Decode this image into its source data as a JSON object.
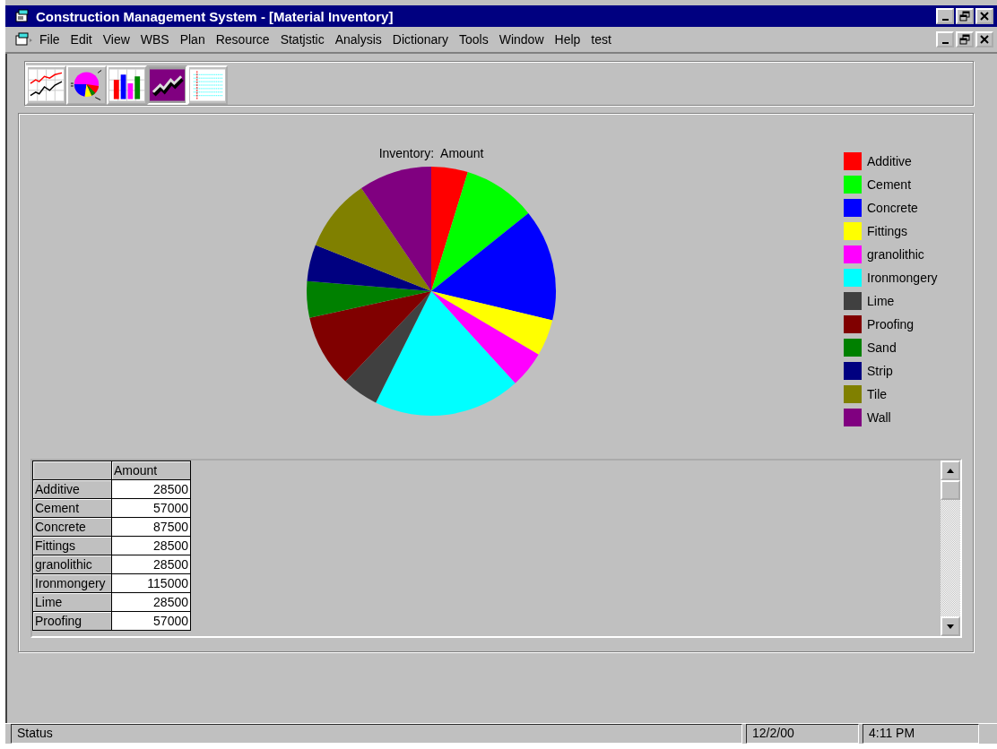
{
  "window": {
    "title": "Construction Management System - [Material Inventory]"
  },
  "menu": [
    "File",
    "Edit",
    "View",
    "WBS",
    "Plan",
    "Resource",
    "Statjstic",
    "Analysis",
    "Dictionary",
    "Tools",
    "Window",
    "Help",
    "test"
  ],
  "toolbar": [
    {
      "kind": "line",
      "selected": false
    },
    {
      "kind": "pie",
      "selected": false
    },
    {
      "kind": "bar",
      "selected": false
    },
    {
      "kind": "trend",
      "selected": true
    },
    {
      "kind": "grid",
      "selected": false
    }
  ],
  "chart": {
    "chart_data": {
      "type": "pie",
      "title": "Inventory:  Amount",
      "categories": [
        "Additive",
        "Cement",
        "Concrete",
        "Fittings",
        "granolithic",
        "Ironmongery",
        "Lime",
        "Proofing",
        "Sand",
        "Strip",
        "Tile",
        "Wall"
      ],
      "values": [
        4.74,
        9.48,
        14.54,
        4.74,
        4.74,
        19.1,
        4.74,
        9.48,
        4.74,
        4.74,
        9.48,
        9.48
      ]
    },
    "legend": [
      {
        "color": "#ff0000"
      },
      {
        "color": "#00ff00"
      },
      {
        "color": "#0000ff"
      },
      {
        "color": "#ffff00"
      },
      {
        "color": "#ff00ff"
      },
      {
        "color": "#00ffff"
      },
      {
        "color": "#404040"
      },
      {
        "color": "#800000"
      },
      {
        "color": "#008000"
      },
      {
        "color": "#000080"
      },
      {
        "color": "#808000"
      },
      {
        "color": "#800080"
      }
    ]
  },
  "table": {
    "columns": [
      "Amount"
    ],
    "rows": [
      {
        "label": "Additive",
        "amount": "28500"
      },
      {
        "label": "Cement",
        "amount": "57000"
      },
      {
        "label": "Concrete",
        "amount": "87500"
      },
      {
        "label": "Fittings",
        "amount": "28500"
      },
      {
        "label": "granolithic",
        "amount": "28500"
      },
      {
        "label": "Ironmongery",
        "amount": "115000"
      },
      {
        "label": "Lime",
        "amount": "28500"
      },
      {
        "label": "Proofing",
        "amount": "57000"
      }
    ]
  },
  "status_bar": {
    "text": "Status",
    "date": "12/2/00",
    "time": "4:11 PM"
  }
}
